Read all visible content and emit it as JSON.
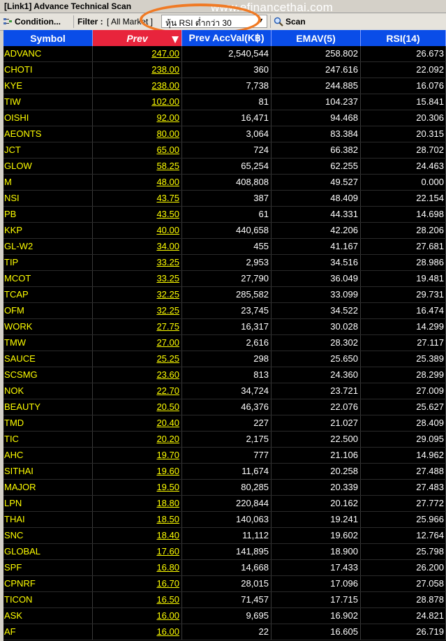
{
  "window": {
    "title": "[Link1] Advance Technical Scan",
    "watermark": "www.efinancethai.com"
  },
  "toolbar": {
    "condition_label": "Condition...",
    "filter_label": "Filter :",
    "market_label": "[ All Market ]",
    "combo_value": "หุ้น RSI ต่ำกว่า 30",
    "scan_label": "Scan"
  },
  "columns": [
    "Symbol",
    "Prev",
    "Prev AccVal(K฿)",
    "EMAV(5)",
    "RSI(14)"
  ],
  "rows": [
    {
      "symbol": "ADVANC",
      "prev": "247.00",
      "accval": "2,540,544",
      "emav": "258.802",
      "rsi": "26.673"
    },
    {
      "symbol": "CHOTI",
      "prev": "238.00",
      "accval": "360",
      "emav": "247.616",
      "rsi": "22.092"
    },
    {
      "symbol": "KYE",
      "prev": "238.00",
      "accval": "7,738",
      "emav": "244.885",
      "rsi": "16.076"
    },
    {
      "symbol": "TIW",
      "prev": "102.00",
      "accval": "81",
      "emav": "104.237",
      "rsi": "15.841"
    },
    {
      "symbol": "OISHI",
      "prev": "92.00",
      "accval": "16,471",
      "emav": "94.468",
      "rsi": "20.306"
    },
    {
      "symbol": "AEONTS",
      "prev": "80.00",
      "accval": "3,064",
      "emav": "83.384",
      "rsi": "20.315"
    },
    {
      "symbol": "JCT",
      "prev": "65.00",
      "accval": "724",
      "emav": "66.382",
      "rsi": "28.702"
    },
    {
      "symbol": "GLOW",
      "prev": "58.25",
      "accval": "65,254",
      "emav": "62.255",
      "rsi": "24.463"
    },
    {
      "symbol": "M",
      "prev": "48.00",
      "accval": "408,808",
      "emav": "49.527",
      "rsi": "0.000"
    },
    {
      "symbol": "NSI",
      "prev": "43.75",
      "accval": "387",
      "emav": "48.409",
      "rsi": "22.154"
    },
    {
      "symbol": "PB",
      "prev": "43.50",
      "accval": "61",
      "emav": "44.331",
      "rsi": "14.698"
    },
    {
      "symbol": "KKP",
      "prev": "40.00",
      "accval": "440,658",
      "emav": "42.206",
      "rsi": "28.206"
    },
    {
      "symbol": "GL-W2",
      "prev": "34.00",
      "accval": "455",
      "emav": "41.167",
      "rsi": "27.681"
    },
    {
      "symbol": "TIP",
      "prev": "33.25",
      "accval": "2,953",
      "emav": "34.516",
      "rsi": "28.986"
    },
    {
      "symbol": "MCOT",
      "prev": "33.25",
      "accval": "27,790",
      "emav": "36.049",
      "rsi": "19.481"
    },
    {
      "symbol": "TCAP",
      "prev": "32.25",
      "accval": "285,582",
      "emav": "33.099",
      "rsi": "29.731"
    },
    {
      "symbol": "OFM",
      "prev": "32.25",
      "accval": "23,745",
      "emav": "34.522",
      "rsi": "16.474"
    },
    {
      "symbol": "WORK",
      "prev": "27.75",
      "accval": "16,317",
      "emav": "30.028",
      "rsi": "14.299"
    },
    {
      "symbol": "TMW",
      "prev": "27.00",
      "accval": "2,616",
      "emav": "28.302",
      "rsi": "27.117"
    },
    {
      "symbol": "SAUCE",
      "prev": "25.25",
      "accval": "298",
      "emav": "25.650",
      "rsi": "25.389"
    },
    {
      "symbol": "SCSMG",
      "prev": "23.60",
      "accval": "813",
      "emav": "24.360",
      "rsi": "28.299"
    },
    {
      "symbol": "NOK",
      "prev": "22.70",
      "accval": "34,724",
      "emav": "23.721",
      "rsi": "27.009"
    },
    {
      "symbol": "BEAUTY",
      "prev": "20.50",
      "accval": "46,376",
      "emav": "22.076",
      "rsi": "25.627"
    },
    {
      "symbol": "TMD",
      "prev": "20.40",
      "accval": "227",
      "emav": "21.027",
      "rsi": "28.409"
    },
    {
      "symbol": "TIC",
      "prev": "20.20",
      "accval": "2,175",
      "emav": "22.500",
      "rsi": "29.095"
    },
    {
      "symbol": "AHC",
      "prev": "19.70",
      "accval": "777",
      "emav": "21.106",
      "rsi": "14.962"
    },
    {
      "symbol": "SITHAI",
      "prev": "19.60",
      "accval": "11,674",
      "emav": "20.258",
      "rsi": "27.488"
    },
    {
      "symbol": "MAJOR",
      "prev": "19.50",
      "accval": "80,285",
      "emav": "20.339",
      "rsi": "27.483"
    },
    {
      "symbol": "LPN",
      "prev": "18.80",
      "accval": "220,844",
      "emav": "20.162",
      "rsi": "27.772"
    },
    {
      "symbol": "THAI",
      "prev": "18.50",
      "accval": "140,063",
      "emav": "19.241",
      "rsi": "25.966"
    },
    {
      "symbol": "SNC",
      "prev": "18.40",
      "accval": "11,112",
      "emav": "19.602",
      "rsi": "12.764"
    },
    {
      "symbol": "GLOBAL",
      "prev": "17.60",
      "accval": "141,895",
      "emav": "18.900",
      "rsi": "25.798"
    },
    {
      "symbol": "SPF",
      "prev": "16.80",
      "accval": "14,668",
      "emav": "17.433",
      "rsi": "26.200"
    },
    {
      "symbol": "CPNRF",
      "prev": "16.70",
      "accval": "28,015",
      "emav": "17.096",
      "rsi": "27.058"
    },
    {
      "symbol": "TICON",
      "prev": "16.50",
      "accval": "71,457",
      "emav": "17.715",
      "rsi": "28.878"
    },
    {
      "symbol": "ASK",
      "prev": "16.00",
      "accval": "9,695",
      "emav": "16.902",
      "rsi": "24.821"
    },
    {
      "symbol": "AF",
      "prev": "16.00",
      "accval": "22",
      "emav": "16.605",
      "rsi": "26.719"
    }
  ]
}
